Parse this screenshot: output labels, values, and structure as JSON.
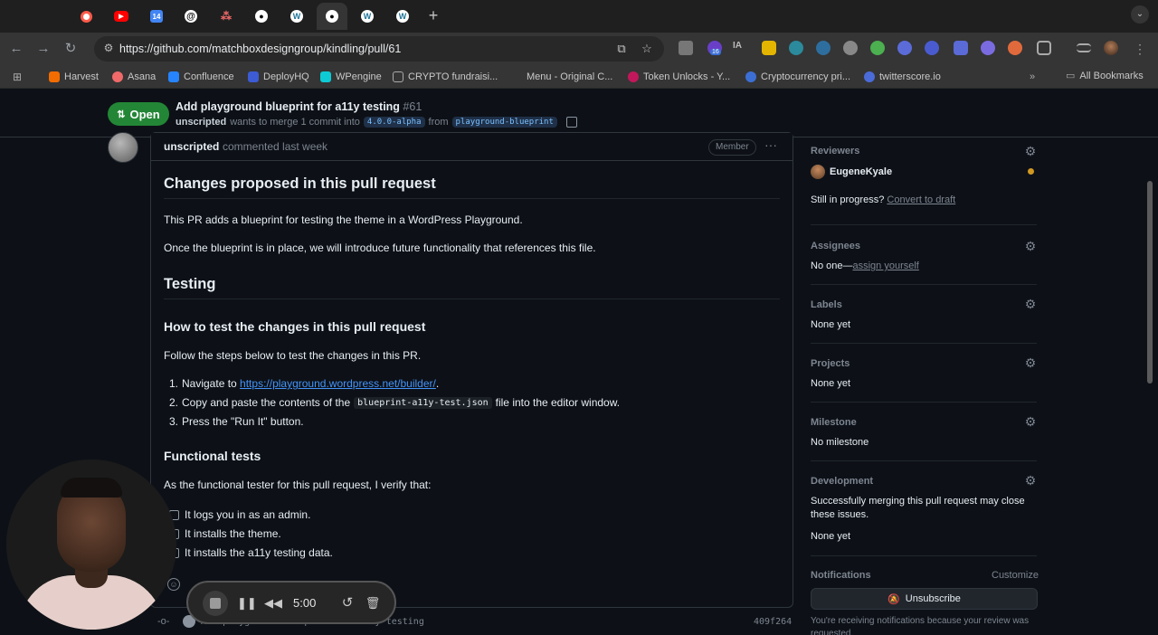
{
  "browser": {
    "tab_icons": [
      "record-tab-icon",
      "youtube-tab-icon",
      "calendar-tab-icon",
      "threads-tab-icon",
      "asana-tab-icon",
      "github-tab-icon",
      "wordpress-tab-icon",
      "github-tab-icon",
      "wordpress-tab-icon",
      "wordpress-tab-icon"
    ],
    "calendar_tab_number": "14",
    "new_tab_label": "+",
    "url": "https://github.com/matchboxdesigngroup/kindling/pull/61",
    "extension_badge": "16",
    "extension_text_ia": "IA",
    "bookmarks": [
      "Harvest",
      "Asana",
      "Confluence",
      "DeployHQ",
      "WPengine",
      "CRYPTO fundraisi...",
      "Menu - Original C...",
      "Token Unlocks - Y...",
      "Cryptocurrency pri...",
      "twitterscore.io"
    ],
    "all_bookmarks": "All Bookmarks",
    "colors": {
      "youtube": "#ff0000",
      "accent": "#4493f8"
    }
  },
  "pr": {
    "state": "Open",
    "title": "Add playground blueprint for a11y testing",
    "number": "#61",
    "author": "unscripted",
    "merge_text": "wants to merge 1 commit into",
    "base_branch": "4.0.0-alpha",
    "from_text": "from",
    "head_branch": "playground-blueprint",
    "state_color": "#238636"
  },
  "comment": {
    "author": "unscripted",
    "action": "commented last week",
    "role": "Member",
    "h_changes": "Changes proposed in this pull request",
    "p_intro": "This PR adds a blueprint for testing the theme in a WordPress Playground.",
    "p_future": "Once the blueprint is in place, we will introduce future functionality that references this file.",
    "h_testing": "Testing",
    "h_how": "How to test the changes in this pull request",
    "p_follow": "Follow the steps below to test the changes in this PR.",
    "step1_pre": "Navigate to ",
    "step1_link": "https://playground.wordpress.net/builder/",
    "step1_post": ".",
    "step2_pre": "Copy and paste the contents of the",
    "step2_code": "blueprint-a11y-test.json",
    "step2_post": "file into the editor window.",
    "step3": "Press the \"Run It\" button.",
    "h_functional": "Functional tests",
    "p_verify": "As the functional tester for this pull request, I verify that:",
    "tasks": [
      "It logs you in as an admin.",
      "It installs the theme.",
      "It installs the a11y testing data."
    ],
    "numbers": [
      "1.",
      "2.",
      "3."
    ]
  },
  "commit": {
    "message": "Add playground blueprint for a11y testing",
    "sha": "409f264"
  },
  "sidebar": {
    "reviewers_label": "Reviewers",
    "reviewer_name": "EugeneKyale",
    "reviewer_status_color": "#d29922",
    "draft_prompt": "Still in progress?",
    "draft_link": "Convert to draft",
    "assignees_label": "Assignees",
    "assignees_none": "No one—",
    "assign_yourself": "assign yourself",
    "labels_label": "Labels",
    "labels_value": "None yet",
    "projects_label": "Projects",
    "projects_value": "None yet",
    "milestone_label": "Milestone",
    "milestone_value": "No milestone",
    "development_label": "Development",
    "development_line1": "Successfully merging this pull request may close",
    "development_line2": "these issues.",
    "development_value": "None yet",
    "notifications_label": "Notifications",
    "customize": "Customize",
    "unsubscribe": "Unsubscribe",
    "notif_note": "You're receiving notifications because your review was requested."
  },
  "recorder": {
    "time": "5:00"
  }
}
